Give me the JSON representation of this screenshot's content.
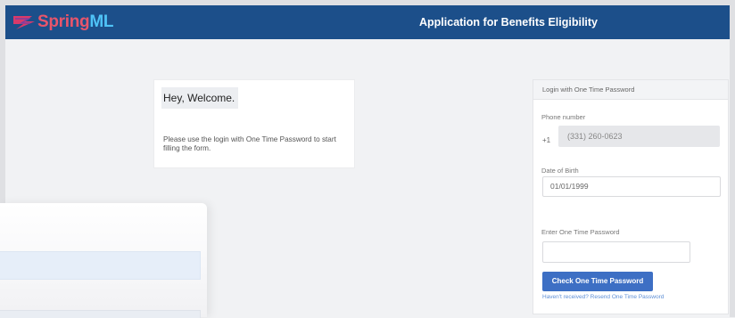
{
  "header": {
    "logo_part1": "Spring",
    "logo_part2": "ML",
    "title": "Application for Benefits Eligibility"
  },
  "welcome": {
    "heading": "Hey, Welcome.",
    "message": "Please use the login with One Time Password to start filling the form."
  },
  "login": {
    "header": "Login with One Time Password",
    "phone_label": "Phone number",
    "phone_prefix": "+1",
    "phone_value": "(331) 260-0623",
    "dob_label": "Date of Birth",
    "dob_value": "01/01/1999",
    "otp_label": "Enter One Time Password",
    "otp_value": "",
    "check_button": "Check One Time Password",
    "resend_link": "Haven't received? Resend One Time Password"
  },
  "colors": {
    "header_bg": "#1c4f8a",
    "primary_button": "#3d6fc4",
    "link": "#5e8fd6",
    "logo_spring": "#e8556b",
    "logo_ml": "#4fc3f7"
  },
  "icons": {
    "logo": "springml-logo-icon"
  }
}
